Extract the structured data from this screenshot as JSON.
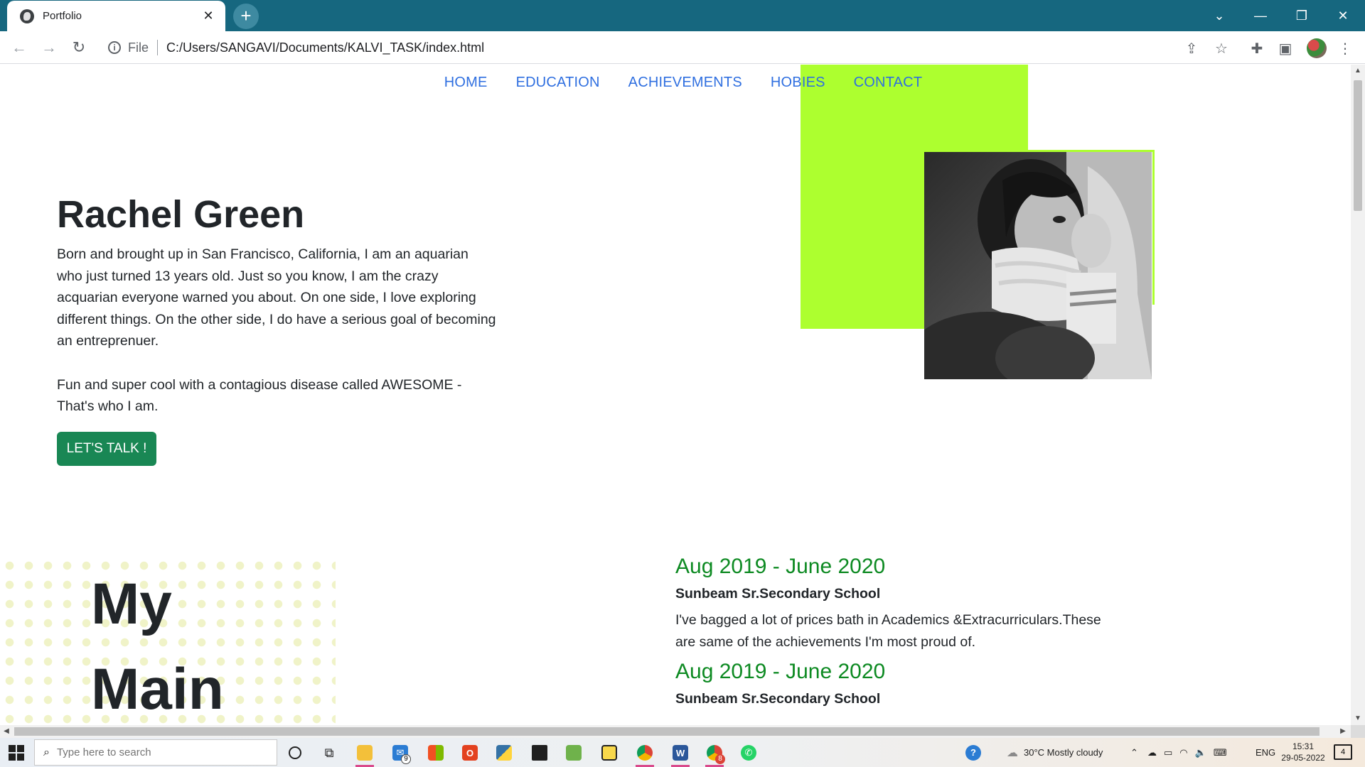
{
  "browser": {
    "tab_title": "Portfolio",
    "tab_close": "✕",
    "new_tab": "+",
    "scheme": "File",
    "url": "C:/Users/SANGAVI/Documents/KALVI_TASK/index.html",
    "window_controls": {
      "tab_search": "⌄",
      "minimize": "—",
      "restore": "❐",
      "close": "✕"
    },
    "nav": {
      "back": "←",
      "forward": "→",
      "reload": "↻"
    },
    "toolbar_icons": {
      "share": "⇪",
      "bookmark": "☆",
      "extensions": "✚",
      "sidepanel": "▣",
      "menu": "⋮"
    }
  },
  "site": {
    "nav": [
      "HOME",
      "EDUCATION",
      "ACHIEVEMENTS",
      "HOBIES",
      "CONTACT"
    ],
    "hero": {
      "name": "Rachel Green",
      "para1": "Born and brought up in San Francisco, California, I am an aquarian who just turned 13 years old. Just so you know, I am the crazy acquarian everyone warned you about. On one side, I love exploring different things. On the other side, I do have a serious goal of becoming an entreprenuer.",
      "para2": "Fun and super cool with a contagious disease called AWESOME - That's who I am.",
      "cta": "LET'S TALK !"
    },
    "section_heading_line1": "My",
    "section_heading_line2": "Main",
    "timeline": [
      {
        "date": "Aug 2019 - June 2020",
        "school": "Sunbeam Sr.Secondary School",
        "desc": "I've bagged a lot of prices bath in Academics &Extracurriculars.These are same of the achievements I'm most proud of."
      },
      {
        "date": "Aug 2019 - June 2020",
        "school": "Sunbeam Sr.Secondary School",
        "desc": ""
      }
    ],
    "colors": {
      "accent_green": "#adff2f",
      "link_blue": "#2f6fe0",
      "button_green": "#198754",
      "date_green": "#0d8a22"
    }
  },
  "taskbar": {
    "search_placeholder": "Type here to search",
    "mail_badge": "9",
    "chrome_badge": "8",
    "weather": "30°C  Mostly cloudy",
    "language": "ENG",
    "time": "15:31",
    "date": "29-05-2022",
    "notification_count": "4"
  }
}
